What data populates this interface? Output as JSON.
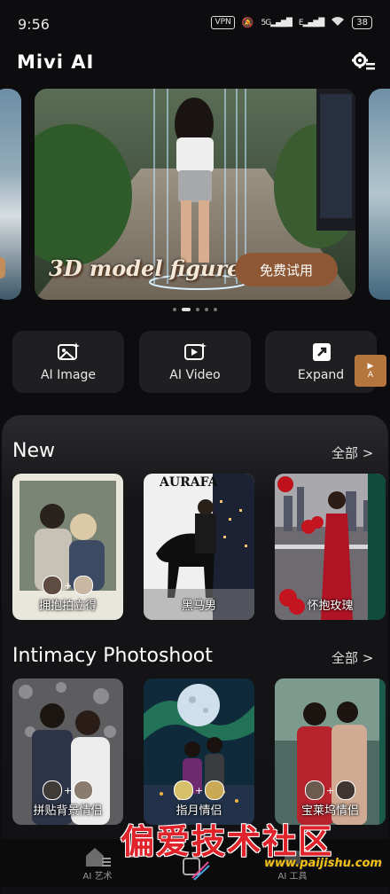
{
  "status_bar": {
    "time": "9:56",
    "vpn": "VPN",
    "network": "5G",
    "network2": "E",
    "battery": "38"
  },
  "app": {
    "title": "Mivi AI",
    "settings_icon": "gear-icon"
  },
  "carousel": {
    "caption": "3D model figure",
    "cta": "免费试用",
    "page_count": 5,
    "active_page": 2
  },
  "tools": [
    {
      "label": "AI Image",
      "icon": "image-sparkle-icon"
    },
    {
      "label": "AI Video",
      "icon": "video-sparkle-icon"
    },
    {
      "label": "Expand",
      "icon": "expand-icon"
    }
  ],
  "tool_ad": {
    "label": "A"
  },
  "sections": {
    "new": {
      "title": "New",
      "more": "全部 >",
      "cards": [
        {
          "label": "拥抱拍立得"
        },
        {
          "label": "黑马男",
          "overlay_text": "AURAFA"
        },
        {
          "label": "怀抱玫瑰"
        }
      ]
    },
    "intimacy": {
      "title": "Intimacy Photoshoot",
      "more": "全部 >",
      "cards": [
        {
          "label": "拼贴背景情侣"
        },
        {
          "label": "指月情侣"
        },
        {
          "label": "宝莱坞情侣"
        }
      ]
    }
  },
  "bottom_nav": [
    {
      "label": "AI 艺术"
    },
    {
      "label": ""
    },
    {
      "label": "AI 工具"
    }
  ],
  "watermark": {
    "text": "偏爱技术社区",
    "url": "www.paijishu.com"
  },
  "colors": {
    "accent": "#8e5834",
    "background": "#0d0d0f",
    "watermark": "#e0222a"
  }
}
